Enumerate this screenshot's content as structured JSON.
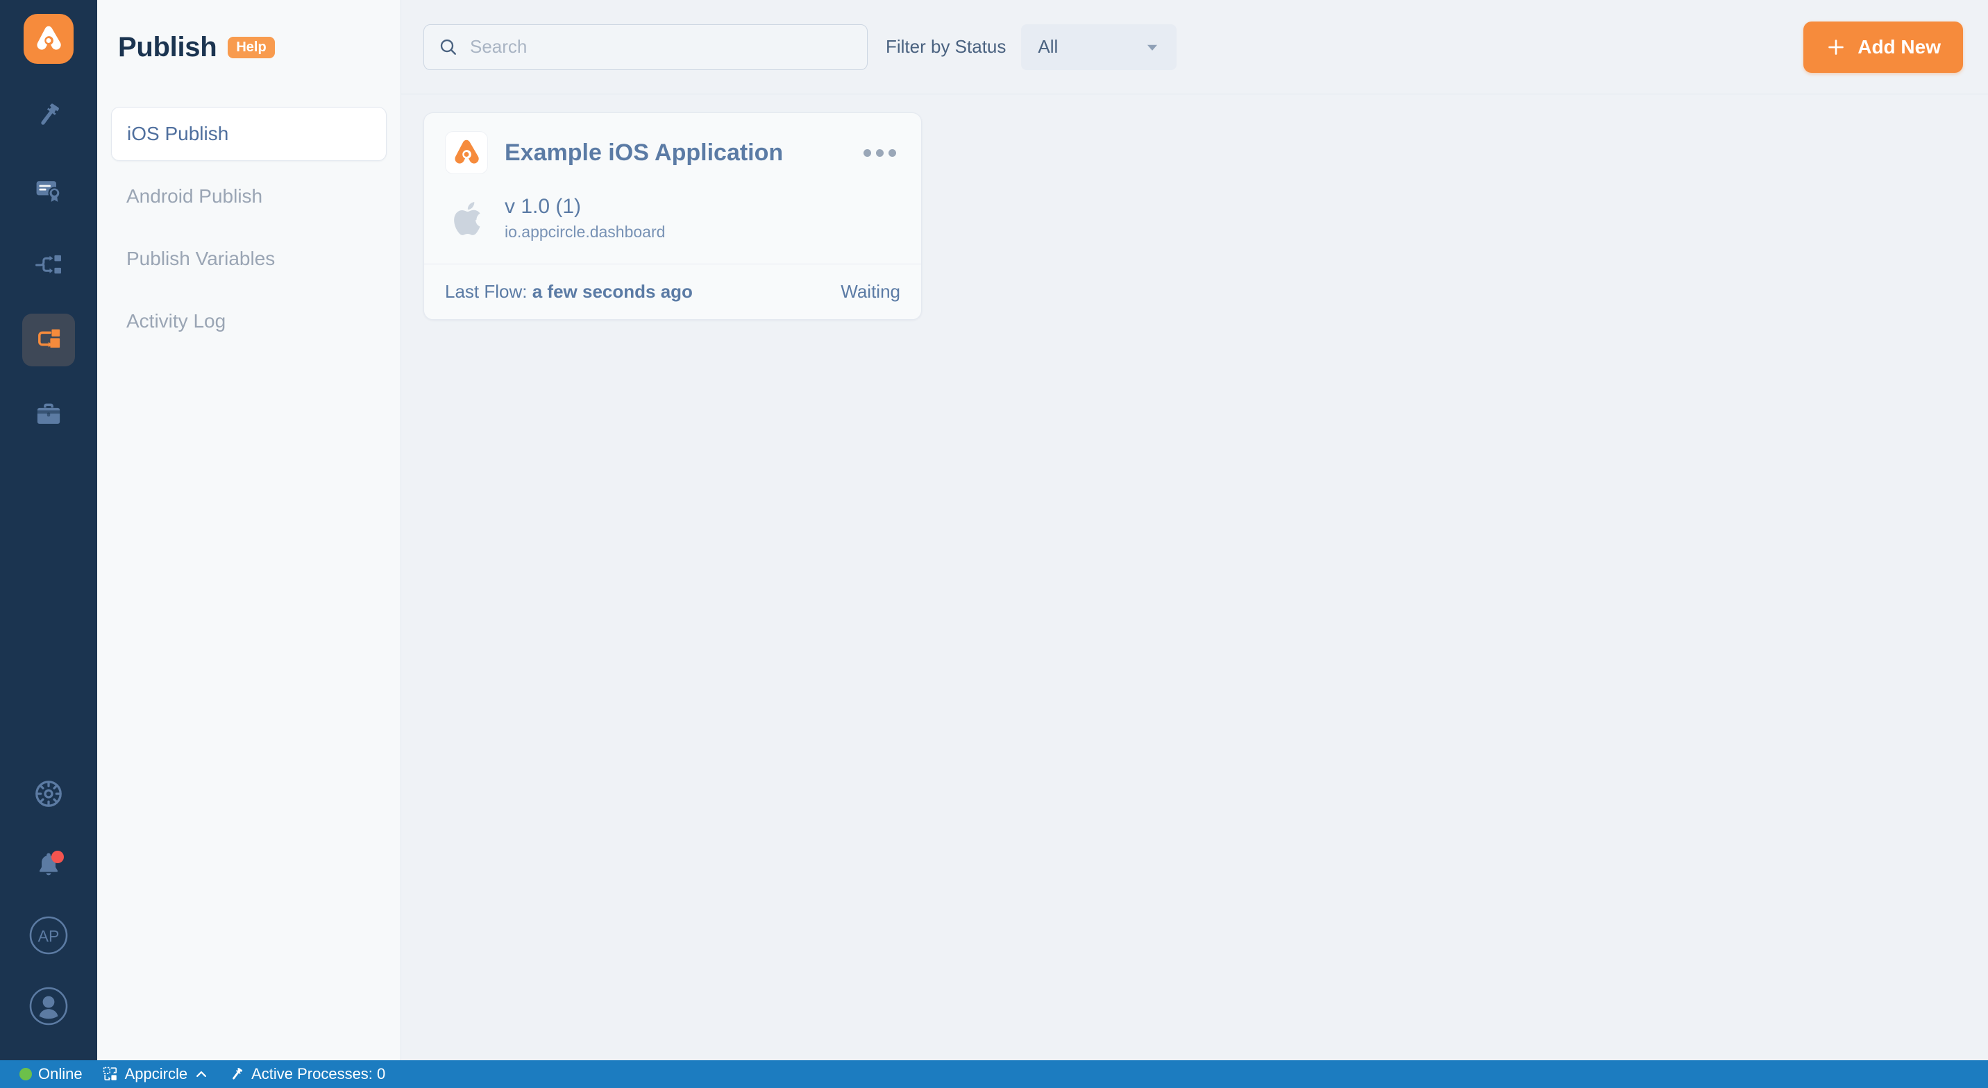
{
  "brand": {
    "logo_icon": "appcircle-logo-icon",
    "accent": "#f68b3c",
    "rail_bg": "#1b3450"
  },
  "rail": {
    "items": [
      {
        "icon": "hammer-build-icon",
        "name": "build",
        "active": false
      },
      {
        "icon": "certificate-signing-icon",
        "name": "signing-identities",
        "active": false
      },
      {
        "icon": "distribute-flow-icon",
        "name": "distribute",
        "active": false
      },
      {
        "icon": "publish-flow-icon",
        "name": "publish",
        "active": true
      },
      {
        "icon": "briefcase-store-icon",
        "name": "store-submit",
        "active": false
      }
    ],
    "bottom_items": [
      {
        "icon": "settings-gear-icon",
        "name": "settings"
      },
      {
        "icon": "bell-notification-icon",
        "name": "notifications",
        "badge": true
      },
      {
        "icon": "organization-avatar-icon",
        "name": "organization",
        "initials": "AP"
      },
      {
        "icon": "user-avatar-icon",
        "name": "account"
      }
    ]
  },
  "sidebar": {
    "title": "Publish",
    "help_label": "Help",
    "items": [
      {
        "label": "iOS Publish",
        "active": true
      },
      {
        "label": "Android Publish",
        "active": false
      },
      {
        "label": "Publish Variables",
        "active": false
      },
      {
        "label": "Activity Log",
        "active": false
      }
    ]
  },
  "toolbar": {
    "search_placeholder": "Search",
    "search_value": "",
    "search_icon": "search-icon",
    "filter_label": "Filter by Status",
    "filter_value": "All",
    "filter_options": [
      "All"
    ],
    "chevron_icon": "chevron-down-icon",
    "add_label": "Add New",
    "add_icon": "plus-icon"
  },
  "apps": [
    {
      "icon": "appcircle-app-icon",
      "name": "Example iOS Application",
      "menu_icon": "more-options-icon",
      "platform_icon": "apple-icon",
      "version": "v 1.0 (1)",
      "bundle_id": "io.appcircle.dashboard",
      "last_flow_prefix": "Last Flow:",
      "last_flow_time": "a few seconds ago",
      "status": "Waiting"
    }
  ],
  "statusbar": {
    "online_label": "Online",
    "online_dot_color": "#6cc04a",
    "remote_icon": "remote-window-icon",
    "remote_label": "Appcircle",
    "remote_chevron_icon": "chevron-up-icon",
    "processes_icon": "hammer-icon",
    "processes_label": "Active Processes: 0"
  }
}
